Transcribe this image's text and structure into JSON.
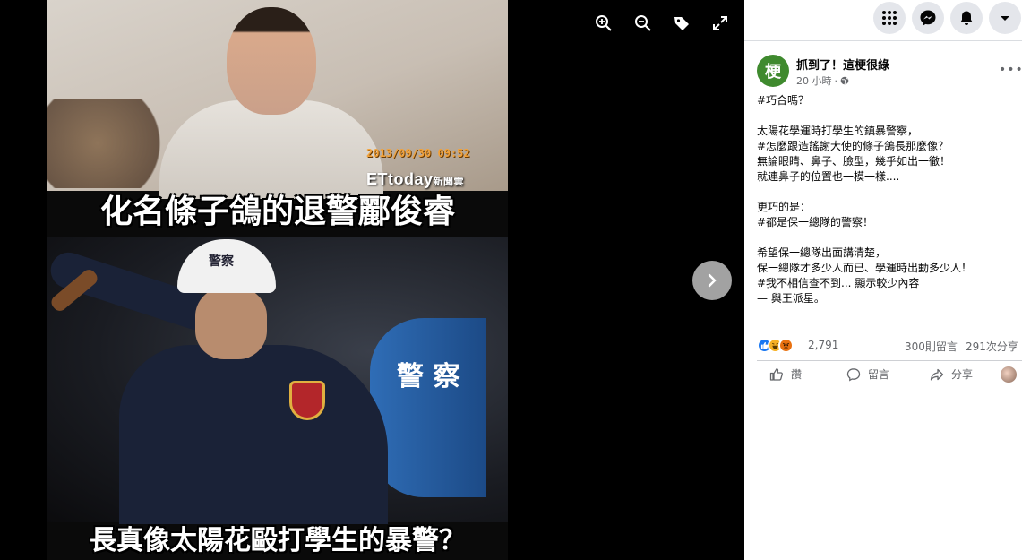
{
  "photo": {
    "timestamp": "2013/09/30  09:52",
    "watermark_brand": "ETtoday",
    "watermark_suffix": "新聞雲",
    "caption_top": "化名條子鴿的退警酈俊睿",
    "caption_bottom": "長真像太陽花毆打學生的暴警？",
    "helmet_text": "警察",
    "shield_text": "警 察"
  },
  "viewer_tools": [
    "zoom-in-icon",
    "zoom-out-icon",
    "tag-icon",
    "fullscreen-icon"
  ],
  "topbar": [
    "menu-grid-icon",
    "messenger-icon",
    "notifications-icon",
    "account-caret-icon"
  ],
  "post": {
    "avatar_text": "梗",
    "page_name": "抓到了！這梗很綠",
    "time": "20 小時",
    "audience_icon": "globe-icon",
    "body": "#巧合嗎？\n\n太陽花學運時打學生的鎮暴警察，\n#怎麼跟造謠謝大使的條子鴿長那麼像？\n無論眼睛、鼻子、臉型，幾乎如出一徹！\n就連鼻子的位置也一模一樣....\n\n更巧的是：\n#都是保一總隊的警察！\n\n希望保一總隊出面講清楚，\n保一總隊才多少人而已、學運時出動多少人！\n#我不相信查不到... 顯示較少內容\n— 與王派星。"
  },
  "stats": {
    "reactions": [
      "like",
      "haha",
      "angry"
    ],
    "reaction_count": "2,791",
    "comments": "300則留言",
    "shares": "291次分享"
  },
  "actions": {
    "like": "讚",
    "comment": "留言",
    "share": "分享"
  },
  "colors": {
    "like": "#1877f2",
    "haha": "#f7b125",
    "angry": "#e9710f",
    "avatar": "#3f8a2e"
  }
}
